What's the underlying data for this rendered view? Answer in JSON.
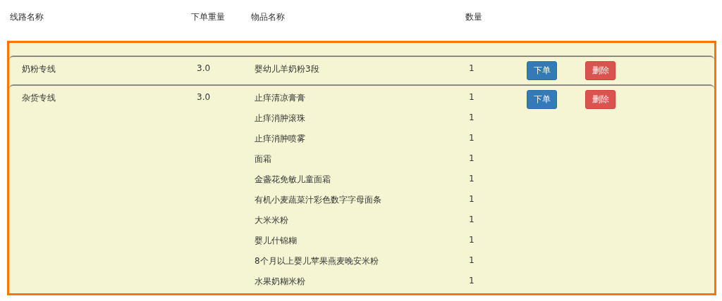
{
  "columns": [
    "线路名称",
    "下单重量",
    "物品名称",
    "数量"
  ],
  "groups": [
    {
      "route": "奶粉专线",
      "weight": "3.0",
      "items": [
        {
          "name": "婴幼儿羊奶粉3段",
          "quantity": "1"
        }
      ],
      "buttons": [
        {
          "label": "下单",
          "kind": "primary"
        },
        {
          "label": "删除",
          "kind": "danger"
        }
      ]
    },
    {
      "route": "杂货专线",
      "weight": "3.0",
      "items": [
        {
          "name": "止痒清凉膏膏",
          "quantity": "1"
        },
        {
          "name": "止痒消肿滚珠",
          "quantity": "1"
        },
        {
          "name": "止痒消肿喷雾",
          "quantity": "1"
        },
        {
          "name": "面霜",
          "quantity": "1"
        },
        {
          "name": "金盏花免敏儿童面霜",
          "quantity": "1"
        },
        {
          "name": "有机小麦蔬菜汁彩色数字字母面条",
          "quantity": "1"
        },
        {
          "name": "大米米粉",
          "quantity": "1"
        },
        {
          "name": "婴儿什锦糊",
          "quantity": "1"
        },
        {
          "name": "8个月以上婴儿苹果燕麦晚安米粉",
          "quantity": "1"
        },
        {
          "name": "水果奶糊米粉",
          "quantity": "1"
        }
      ],
      "buttons": [
        {
          "label": "下单",
          "kind": "primary"
        },
        {
          "label": "删除",
          "kind": "danger"
        }
      ]
    }
  ]
}
